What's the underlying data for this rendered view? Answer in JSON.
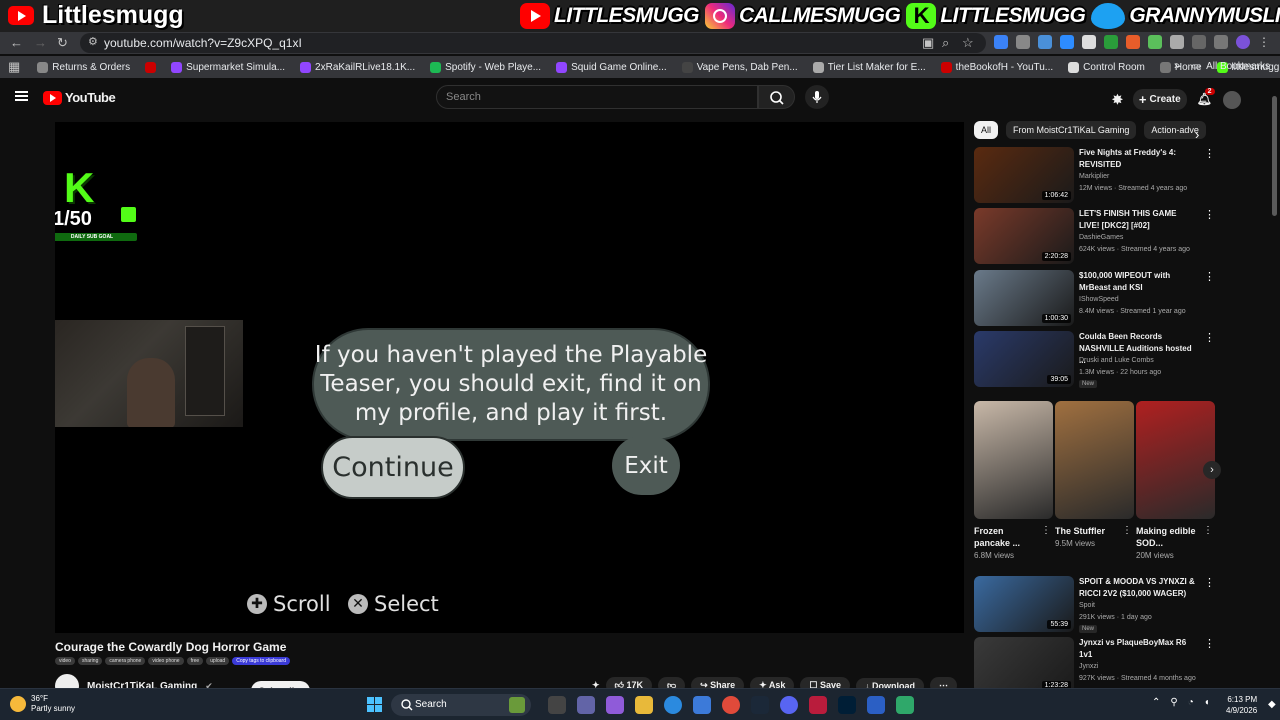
{
  "stream_overlay": {
    "title": "Littlesmugg",
    "socials": [
      {
        "icon": "youtube-icon",
        "handle": "LITTLESMUGG"
      },
      {
        "icon": "instagram-icon",
        "handle": "CALLMESMUGG"
      },
      {
        "icon": "kick-icon",
        "handle": "LITTLESMUGG"
      },
      {
        "icon": "twitter-icon",
        "handle": "GRANNYMUSLIM"
      }
    ],
    "sub_goal": {
      "brand": "K",
      "count": "1/50",
      "label": "DAILY SUB GOAL"
    }
  },
  "browser": {
    "url": "youtube.com/watch?v=Z9cXPQ_q1xI",
    "bookmarks": [
      {
        "label": "Returns & Orders",
        "color": "#888888"
      },
      {
        "label": "",
        "color": "#cc0000"
      },
      {
        "label": "Supermarket Simula...",
        "color": "#9146ff"
      },
      {
        "label": "2xRaKailRLive18.1K...",
        "color": "#9146ff"
      },
      {
        "label": "Spotify - Web Playe...",
        "color": "#1db954"
      },
      {
        "label": "Squid Game Online...",
        "color": "#9146ff"
      },
      {
        "label": "Vape Pens, Dab Pen...",
        "color": "#444444"
      },
      {
        "label": "Tier List Maker for E...",
        "color": "#aaaaaa"
      },
      {
        "label": "theBookofH - YouTu...",
        "color": "#cc0000"
      },
      {
        "label": "Control Room",
        "color": "#dddddd"
      },
      {
        "label": "Home",
        "color": "#777777"
      },
      {
        "label": "littlesmugg - KickBot",
        "color": "#53fc18"
      }
    ],
    "all_bookmarks_label": "All Bookmarks"
  },
  "youtube": {
    "logo_text": "YouTube",
    "search_placeholder": "Search",
    "create_label": "Create",
    "notification_count": "2",
    "video": {
      "dialog_text": "If you haven't played the Playable Teaser, you should exit, find it on my profile, and play it first.",
      "continue_label": "Continue",
      "exit_label": "Exit",
      "hint_scroll": "Scroll",
      "hint_select": "Select"
    },
    "title": "Courage the Cowardly Dog Horror Game",
    "tags": [
      "video",
      "sharing",
      "camera phone",
      "video phone",
      "free",
      "upload"
    ],
    "copy_tags_label": "Copy tags to clipboard",
    "channel_name": "MoistCr1TiKaL Gaming",
    "subscribe_label": "Subscribe",
    "actions": {
      "likes": "17K",
      "share": "Share",
      "ask": "Ask",
      "save": "Save",
      "download": "Download"
    },
    "chips": [
      {
        "label": "All",
        "active": true
      },
      {
        "label": "From MoistCr1TiKaL Gaming",
        "active": false
      },
      {
        "label": "Action-adve",
        "active": false
      }
    ],
    "recommendations": [
      {
        "title": "Five Nights at Freddy's 4: REVISITED",
        "channel": "Markiplier",
        "meta": "12M views · Streamed 4 years ago",
        "duration": "1:06:42",
        "is_new": false,
        "thumb": "#5a2a10"
      },
      {
        "title": "LET'S FINISH THIS GAME LIVE! [DKC2] [#02]",
        "channel": "DashieGames",
        "meta": "624K views · Streamed 4 years ago",
        "duration": "2:20:28",
        "is_new": false,
        "thumb": "#7a3a2a"
      },
      {
        "title": "$100,000 WIPEOUT with MrBeast and KSI",
        "channel": "IShowSpeed",
        "meta": "8.4M views · Streamed 1 year ago",
        "duration": "1:00:30",
        "is_new": false,
        "thumb": "#6a7a8a"
      },
      {
        "title": "Coulda Been Records NASHVILLE Auditions hosted ...",
        "channel": "Druski and Luke Combs",
        "meta": "1.3M views · 22 hours ago",
        "duration": "39:05",
        "is_new": true,
        "thumb": "#2a3a6a"
      }
    ],
    "shorts": [
      {
        "title": "Frozen pancake ...",
        "views": "6.8M views",
        "thumb": "#c8b8a8"
      },
      {
        "title": "The Stuffler",
        "views": "9.5M views",
        "thumb": "#a07040"
      },
      {
        "title": "Making edible SOD...",
        "views": "20M views",
        "thumb": "#b02020"
      }
    ],
    "recommendations_2": [
      {
        "title": "SPOIT & MOODA VS JYNXZI & RICCI 2V2 ($10,000 WAGER)",
        "channel": "Spoit",
        "meta": "291K views · 1 day ago",
        "duration": "55:39",
        "is_new": true,
        "thumb": "#3a6aa0"
      },
      {
        "title": "Jynxzi vs PlaqueBoyMax R6 1v1",
        "channel": "Jynxzi",
        "meta": "927K views · Streamed 4 months ago",
        "duration": "1:23:28",
        "is_new": false,
        "thumb": "#3a3a3a"
      }
    ],
    "new_badge": "New"
  },
  "taskbar": {
    "weather_temp": "36°F",
    "weather_desc": "Partly sunny",
    "search_label": "Search",
    "time": "6:13 PM",
    "date": "4/9/2026"
  }
}
